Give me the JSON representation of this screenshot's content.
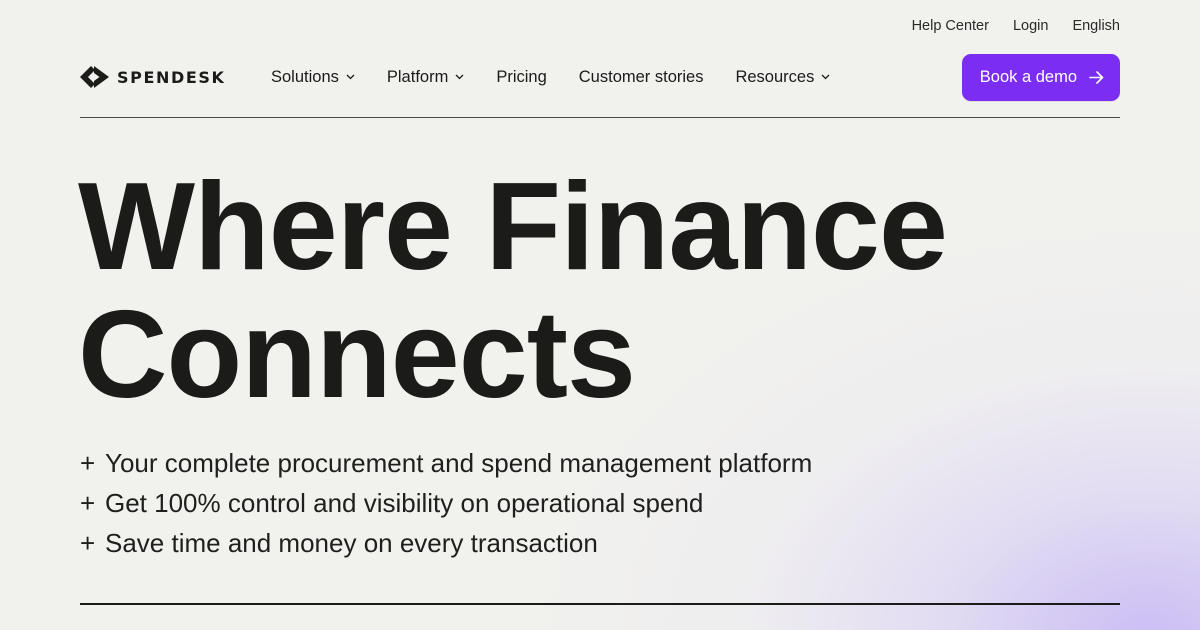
{
  "utility_nav": {
    "help_center": "Help Center",
    "login": "Login",
    "language": "English"
  },
  "brand": {
    "name": "SPENDESK",
    "logo_icon": "spendesk-chevron-logo-icon"
  },
  "main_nav": {
    "items": [
      {
        "label": "Solutions",
        "has_dropdown": true
      },
      {
        "label": "Platform",
        "has_dropdown": true
      },
      {
        "label": "Pricing",
        "has_dropdown": false
      },
      {
        "label": "Customer stories",
        "has_dropdown": false
      },
      {
        "label": "Resources",
        "has_dropdown": true
      }
    ]
  },
  "cta": {
    "label": "Book a demo",
    "icon": "arrow-right-icon"
  },
  "hero": {
    "headline_line1": "Where Finance",
    "headline_line2": "Connects",
    "bullets": [
      {
        "marker": "+",
        "text": "Your complete procurement and spend management platform"
      },
      {
        "marker": "+",
        "text": "Get 100% control and visibility on operational spend"
      },
      {
        "marker": "+",
        "text": "Save time and money on every transaction"
      }
    ]
  },
  "colors": {
    "accent": "#7b2ef2",
    "text": "#1b1b1a",
    "background": "#f1f1ee",
    "glow": "#c4b4f5"
  }
}
